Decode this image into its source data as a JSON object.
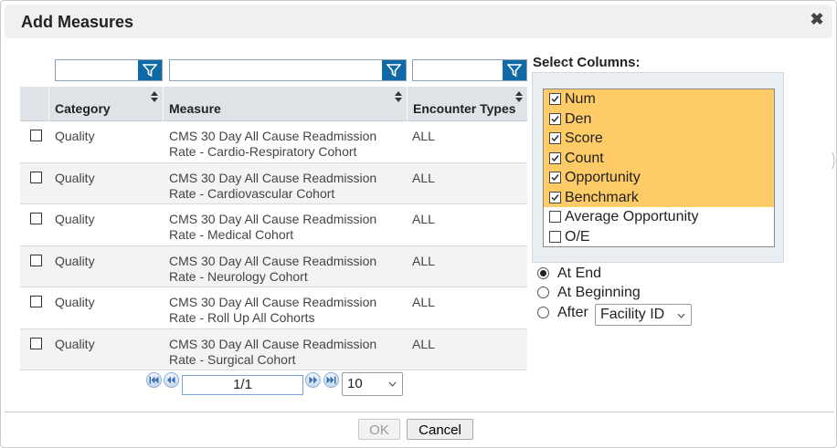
{
  "dialog": {
    "title": "Add Measures"
  },
  "grid": {
    "columns": [
      "Category",
      "Measure",
      "Encounter Types"
    ],
    "rows": [
      {
        "category": "Quality",
        "measure_line1": "CMS 30 Day All Cause Readmission",
        "measure_line2": "Rate - Cardio-Respiratory Cohort",
        "encounter": "ALL"
      },
      {
        "category": "Quality",
        "measure_line1": "CMS 30 Day All Cause Readmission",
        "measure_line2": "Rate - Cardiovascular Cohort",
        "encounter": "ALL"
      },
      {
        "category": "Quality",
        "measure_line1": "CMS 30 Day All Cause Readmission",
        "measure_line2": "Rate - Medical Cohort",
        "encounter": "ALL"
      },
      {
        "category": "Quality",
        "measure_line1": "CMS 30 Day All Cause Readmission",
        "measure_line2": "Rate - Neurology Cohort",
        "encounter": "ALL"
      },
      {
        "category": "Quality",
        "measure_line1": "CMS 30 Day All Cause Readmission",
        "measure_line2": "Rate - Roll Up All Cohorts",
        "encounter": "ALL"
      },
      {
        "category": "Quality",
        "measure_line1": "CMS 30 Day All Cause Readmission",
        "measure_line2": "Rate - Surgical Cohort",
        "encounter": "ALL"
      }
    ]
  },
  "pager": {
    "page": "1/1",
    "page_size": "10"
  },
  "select_columns": {
    "title": "Select Columns:",
    "items": [
      {
        "label": "Num",
        "checked": true
      },
      {
        "label": "Den",
        "checked": true
      },
      {
        "label": "Score",
        "checked": true
      },
      {
        "label": "Count",
        "checked": true
      },
      {
        "label": "Opportunity",
        "checked": true
      },
      {
        "label": "Benchmark",
        "checked": true
      },
      {
        "label": "Average Opportunity",
        "checked": false
      },
      {
        "label": "O/E",
        "checked": false
      }
    ]
  },
  "position": {
    "options": [
      {
        "label": "At End",
        "selected": true
      },
      {
        "label": "At Beginning",
        "selected": false
      },
      {
        "label": "After",
        "selected": false
      }
    ],
    "after_value": "Facility ID"
  },
  "footer": {
    "ok_label": "OK",
    "cancel_label": "Cancel"
  },
  "colors": {
    "filter_button": "#0f6aa6",
    "selected_item": "#fecb66",
    "header_bg": "#dfe3e7"
  }
}
